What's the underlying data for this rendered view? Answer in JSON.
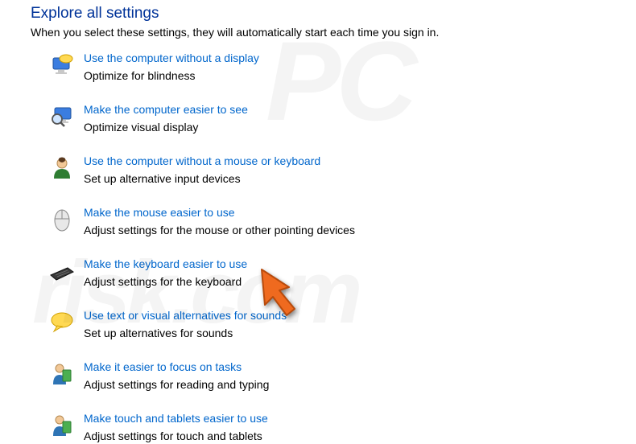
{
  "header": {
    "title": "Explore all settings",
    "subtitle": "When you select these settings, they will automatically start each time you sign in."
  },
  "settings": [
    {
      "icon": "monitor-speech-icon",
      "link": "Use the computer without a display",
      "desc": "Optimize for blindness"
    },
    {
      "icon": "monitor-magnifier-icon",
      "link": "Make the computer easier to see",
      "desc": "Optimize visual display"
    },
    {
      "icon": "user-profile-icon",
      "link": "Use the computer without a mouse or keyboard",
      "desc": "Set up alternative input devices"
    },
    {
      "icon": "mouse-icon",
      "link": "Make the mouse easier to use",
      "desc": "Adjust settings for the mouse or other pointing devices"
    },
    {
      "icon": "keyboard-icon",
      "link": "Make the keyboard easier to use",
      "desc": "Adjust settings for the keyboard"
    },
    {
      "icon": "speech-bubble-icon",
      "link": "Use text or visual alternatives for sounds",
      "desc": "Set up alternatives for sounds"
    },
    {
      "icon": "user-book-icon",
      "link": "Make it easier to focus on tasks",
      "desc": "Adjust settings for reading and typing"
    },
    {
      "icon": "user-book-icon",
      "link": "Make touch and tablets easier to use",
      "desc": "Adjust settings for touch and tablets"
    }
  ],
  "watermark": {
    "top": "PC",
    "bottom": "risk.com"
  }
}
